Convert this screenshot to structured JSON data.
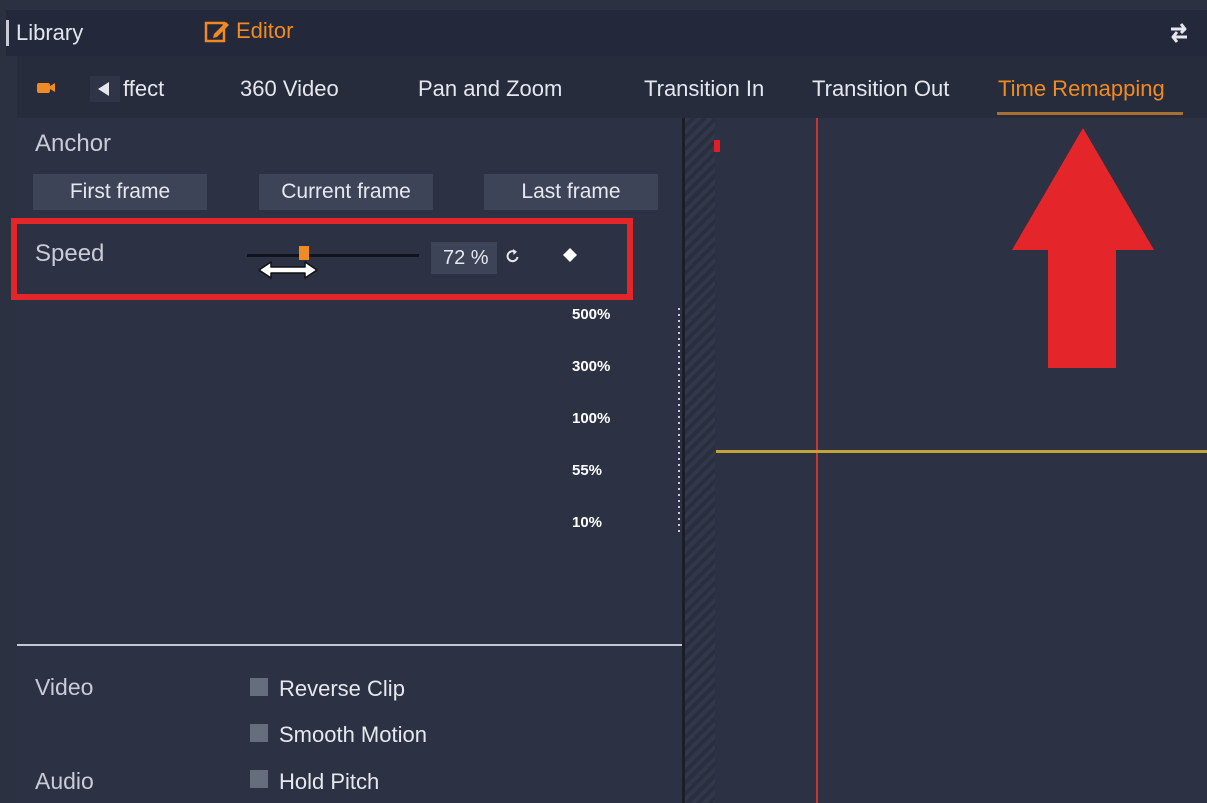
{
  "topbar": {
    "library": "Library",
    "editor": "Editor"
  },
  "tabs": [
    {
      "label": "ffect",
      "active": false
    },
    {
      "label": "360 Video",
      "active": false
    },
    {
      "label": "Pan and Zoom",
      "active": false
    },
    {
      "label": "Transition In",
      "active": false
    },
    {
      "label": "Transition Out",
      "active": false
    },
    {
      "label": "Time Remapping",
      "active": true
    }
  ],
  "anchor": {
    "label": "Anchor",
    "buttons": [
      "First frame",
      "Current frame",
      "Last frame"
    ]
  },
  "speed": {
    "label": "Speed",
    "value": "72 %",
    "slider_value": 72
  },
  "scale": [
    "500%",
    "300%",
    "100%",
    "55%",
    "10%"
  ],
  "video": {
    "label": "Video",
    "options": [
      {
        "label": "Reverse Clip",
        "checked": false
      },
      {
        "label": "Smooth Motion",
        "checked": false
      }
    ]
  },
  "audio": {
    "label": "Audio",
    "options": [
      {
        "label": "Hold Pitch",
        "checked": false
      }
    ]
  },
  "colors": {
    "accent": "#f08a22",
    "highlight": "#e4262a",
    "playhead": "#c6352f",
    "speed_curve": "#c2a33a",
    "panel_bg": "#2c3243"
  },
  "icons": [
    "pencil-square-icon",
    "swap-arrows-icon",
    "camera-icon",
    "chevron-left-icon",
    "reset-icon",
    "keyframe-diamond-icon",
    "double-arrow-icon",
    "up-arrow-icon"
  ]
}
